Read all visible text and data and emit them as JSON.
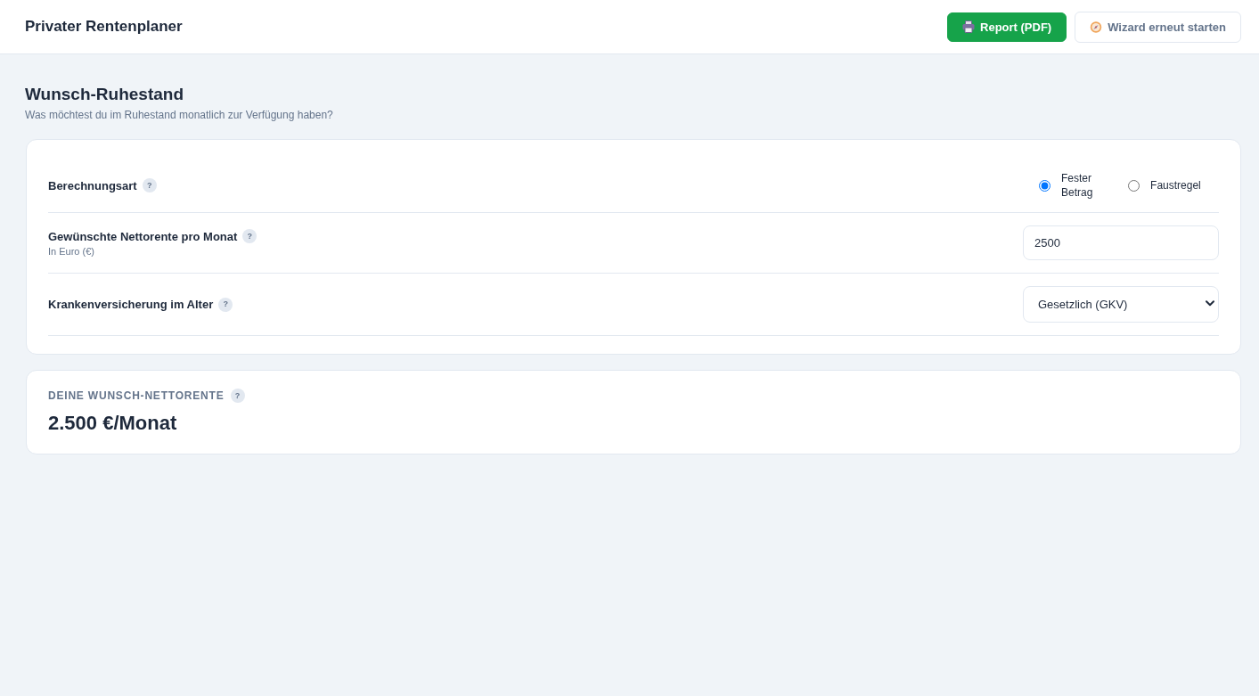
{
  "header": {
    "title": "Privater Rentenplaner",
    "buttons": [
      {
        "kind": "report",
        "label": "Report (PDF)"
      },
      {
        "kind": "wizard",
        "label": "Wizard erneut starten"
      }
    ]
  },
  "section": {
    "title": "Wunsch-Ruhestand",
    "subtitle": "Was möchtest du im Ruhestand monatlich zur Verfügung haben?"
  },
  "form": {
    "rows": [
      {
        "kind": "radio",
        "label": "Berechnungsart",
        "help": "?",
        "options": [
          {
            "label": "Fester Betrag",
            "selected": true
          },
          {
            "label": "Faustregel",
            "selected": false
          }
        ]
      },
      {
        "kind": "number",
        "label": "Gewünschte Nettorente pro Monat",
        "help": "?",
        "hint": "In Euro (€)",
        "value": "2500"
      },
      {
        "kind": "select",
        "label": "Krankenversicherung im Alter",
        "help": "?",
        "value": "Gesetzlich (GKV)"
      }
    ]
  },
  "summary": {
    "label": "DEINE WUNSCH-NETTORENTE",
    "help": "?",
    "value": "2.500 €/Monat"
  }
}
